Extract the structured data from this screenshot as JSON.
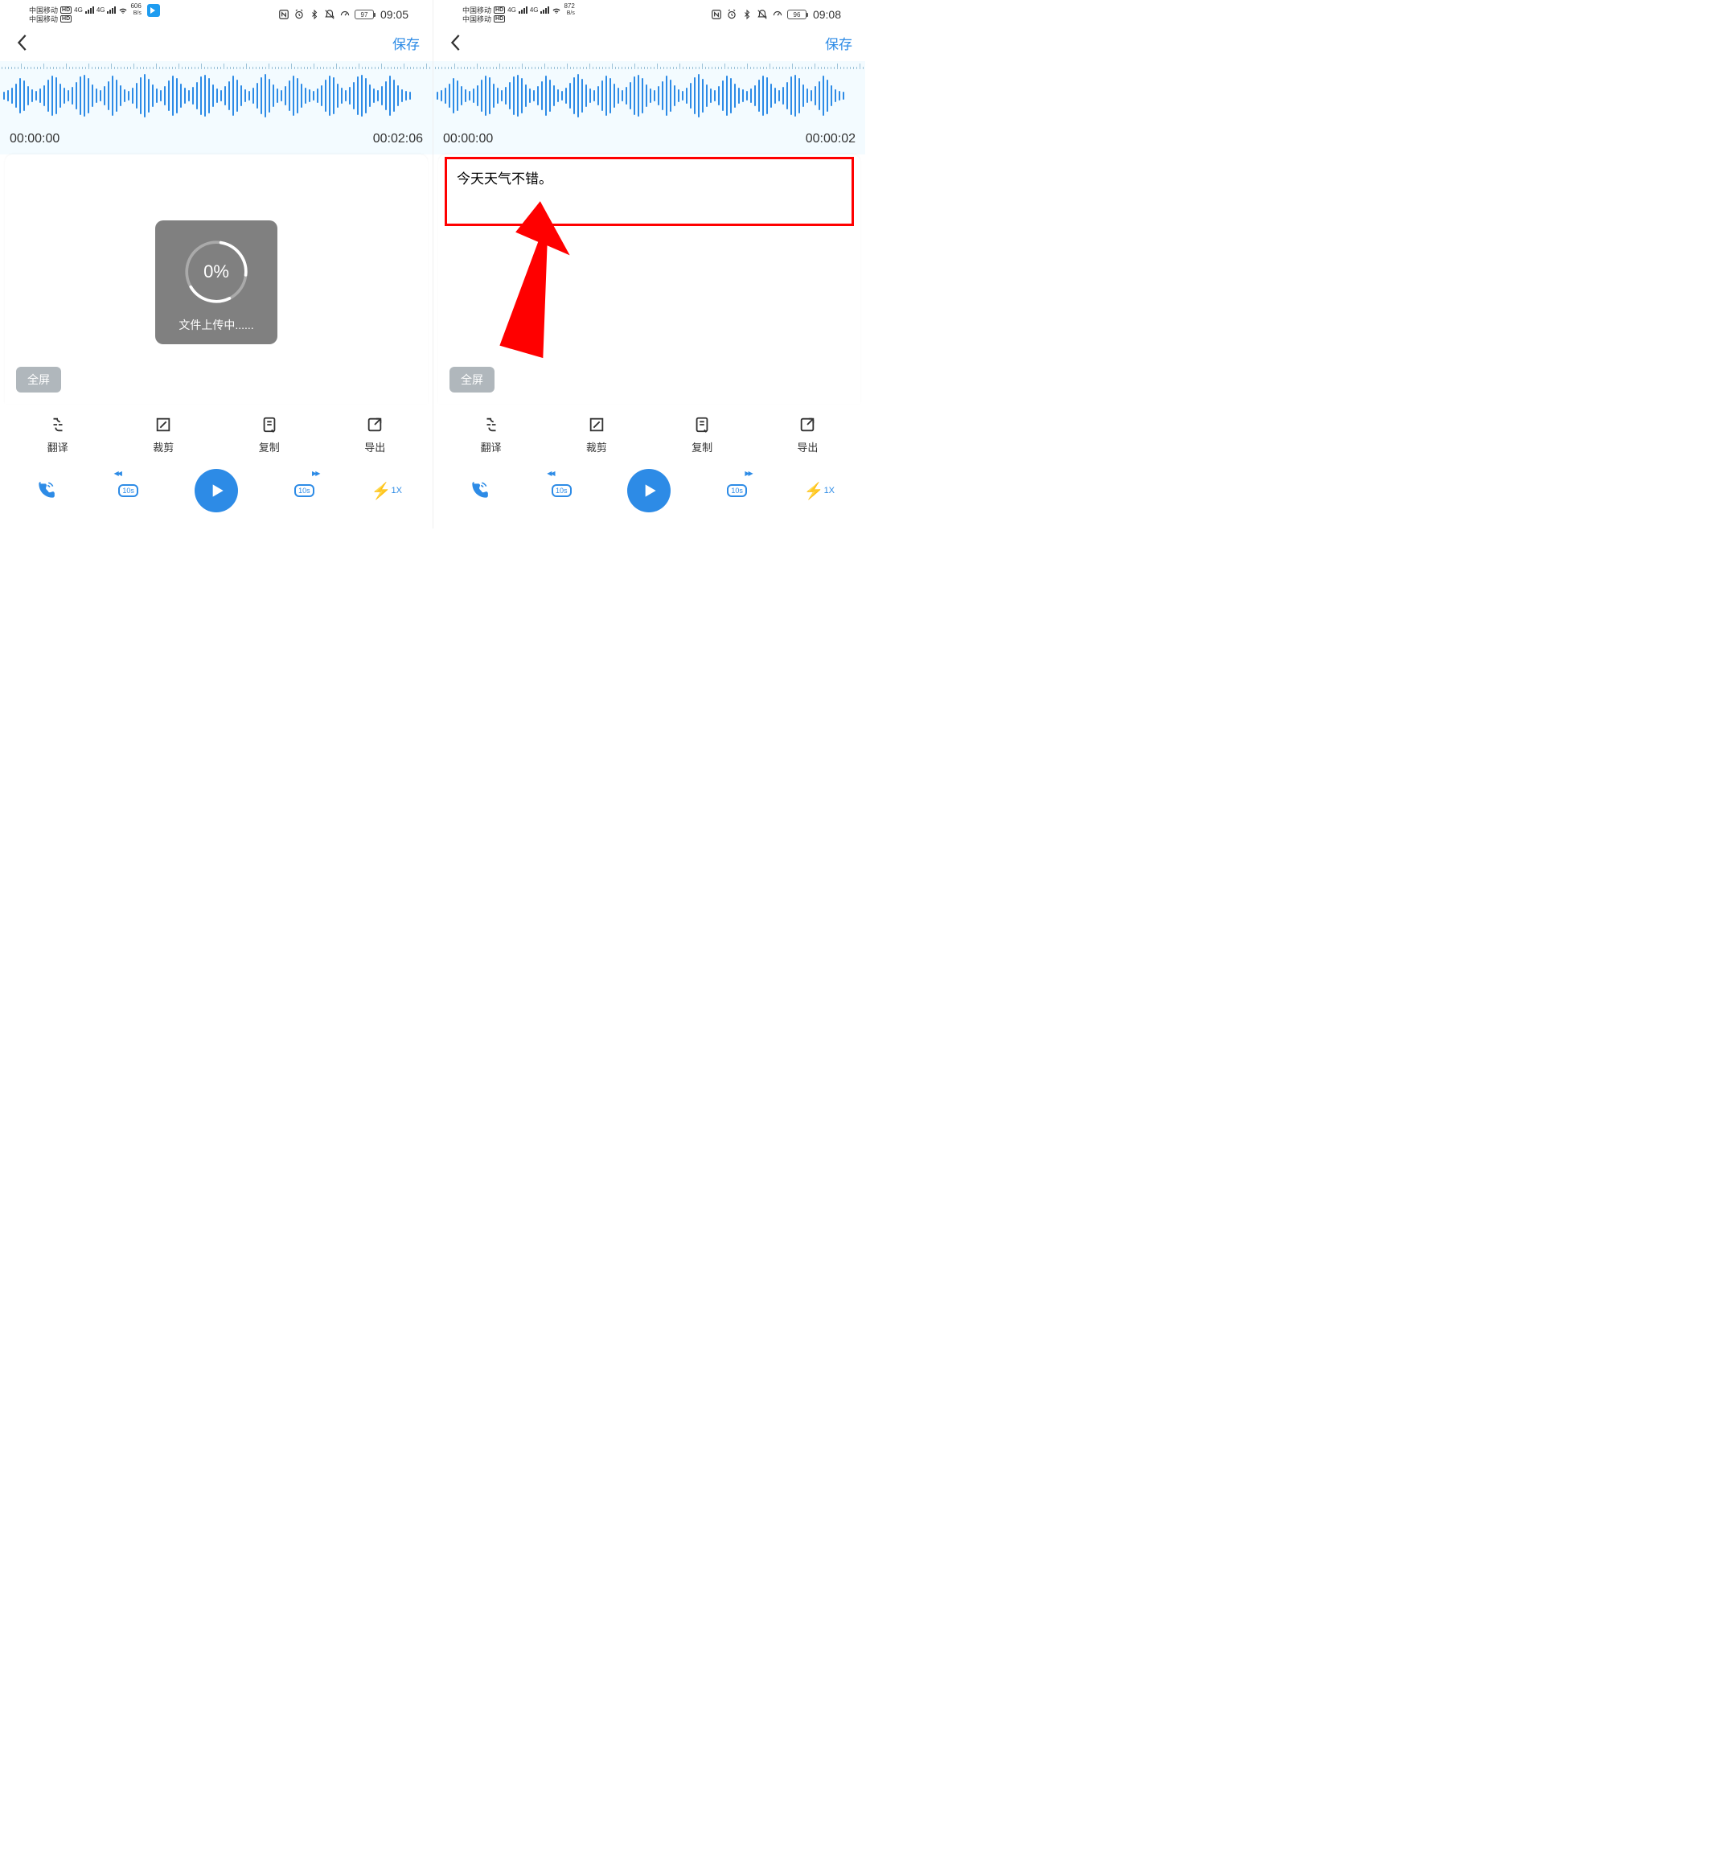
{
  "screens": [
    {
      "status": {
        "carrier": "中国移动",
        "hd": "HD",
        "nettype": "4G",
        "rate": "606",
        "rate_unit": "B/s",
        "battery": "97",
        "time": "09:05",
        "app_badge": true
      },
      "nav": {
        "save": "保存"
      },
      "time_start": "00:00:00",
      "time_end": "00:02:06",
      "upload": {
        "percent": "0%",
        "text": "文件上传中......"
      },
      "fullscreen": "全屏"
    },
    {
      "status": {
        "carrier": "中国移动",
        "hd": "HD",
        "nettype": "4G",
        "rate": "872",
        "rate_unit": "B/s",
        "battery": "96",
        "time": "09:08",
        "app_badge": false
      },
      "nav": {
        "save": "保存"
      },
      "time_start": "00:00:00",
      "time_end": "00:00:02",
      "transcript": "今天天气不错。",
      "fullscreen": "全屏"
    }
  ],
  "actions": {
    "translate": "翻译",
    "crop": "裁剪",
    "copy": "复制",
    "export": "导出"
  },
  "player": {
    "seek_back": "10s",
    "seek_fwd": "10s",
    "speed": "1X"
  }
}
